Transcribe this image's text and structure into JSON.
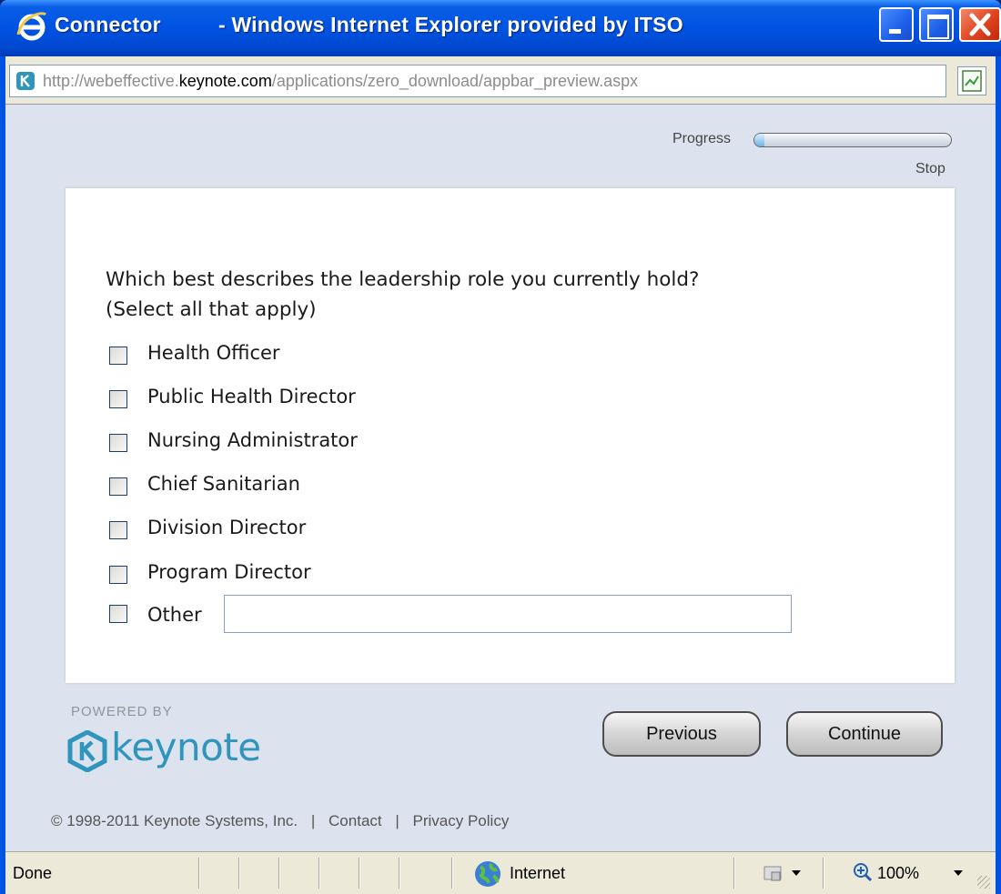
{
  "window": {
    "app_name": "Connector",
    "title_rest": "- Windows Internet Explorer provided by ITSO",
    "icons": {
      "app": "ie-logo-icon",
      "minimize": "minimize-icon",
      "maximize": "maximize-icon",
      "close": "close-icon"
    }
  },
  "address": {
    "url_prefix": "http://webeffective.",
    "url_domain": "keynote.com",
    "url_suffix": "/applications/zero_download/appbar_preview.aspx",
    "site_icon": "keynote-favicon-icon",
    "feed_icon": "feed-icon"
  },
  "survey": {
    "progress_label": "Progress",
    "progress_fraction": 0.05,
    "stop_label": "Stop",
    "question": "Which best describes the leadership role you currently hold?",
    "question_hint": "(Select all that apply)",
    "options": [
      "Health Officer",
      "Public Health Director",
      "Nursing Administrator",
      "Chief Sanitarian",
      "Division Director",
      "Program Director",
      "Other"
    ],
    "other_value": "",
    "previous_label": "Previous",
    "continue_label": "Continue"
  },
  "branding": {
    "powered_by": "POWERED BY",
    "wordmark": "keynote",
    "copyright": "© 1998-2011 Keynote Systems, Inc.",
    "contact_label": "Contact",
    "privacy_label": "Privacy Policy",
    "separator": "|",
    "colors": {
      "brand": "#2f95bd",
      "progress_fill": "#6fb2e7",
      "panel_bg": "#dde3ee"
    }
  },
  "status": {
    "text": "Done",
    "zone_label": "Internet",
    "zoom_label": "100%"
  }
}
